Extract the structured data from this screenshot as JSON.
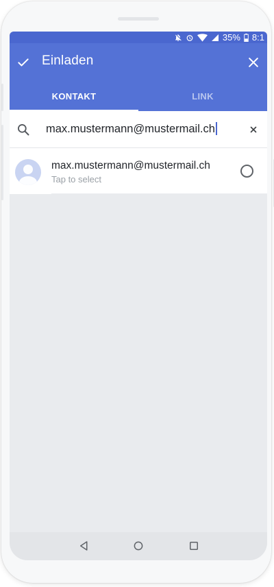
{
  "status_bar": {
    "battery_percent": "35%",
    "time": "8:1"
  },
  "app_bar": {
    "title": "Einladen"
  },
  "tabs": [
    {
      "label": "KONTAKT",
      "active": true
    },
    {
      "label": "LINK",
      "active": false
    }
  ],
  "search": {
    "value": "max.mustermann@mustermail.ch"
  },
  "results": [
    {
      "email": "max.mustermann@mustermail.ch",
      "hint": "Tap to select",
      "selected": false
    }
  ],
  "colors": {
    "primary": "#5472d6",
    "status_bar": "#4a67cf",
    "background": "#e9ebee",
    "avatar": "#c9d4f2"
  },
  "icons": {
    "status": [
      "notifications-off-icon",
      "alarm-icon",
      "wifi-icon",
      "signal-icon",
      "battery-icon"
    ],
    "app_bar": [
      "check-icon",
      "close-icon"
    ],
    "search": [
      "search-icon",
      "clear-icon"
    ],
    "navigation": [
      "back-icon",
      "home-icon",
      "recents-icon"
    ]
  }
}
